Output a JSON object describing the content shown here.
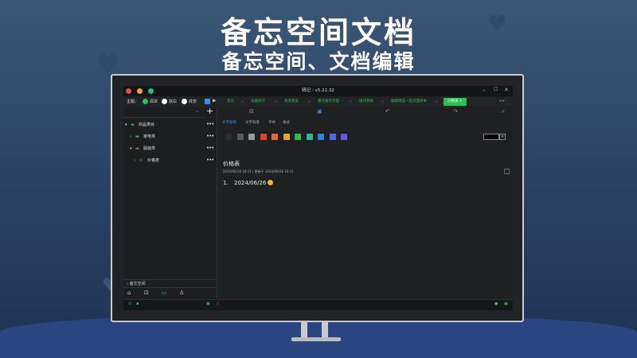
{
  "promo": {
    "title": "备忘空间文档",
    "subtitle": "备忘空间、文档编辑"
  },
  "window": {
    "title": "晴记 - v5.22.32"
  },
  "toolbar": {
    "theme_label": "主题:",
    "theme_options": [
      "翡翠",
      "默白",
      "抹茶"
    ],
    "tabs": [
      "首页",
      "设置统计",
      "背景图案",
      "重点展示页面",
      "操作系统",
      "编辑精选一些页面样本",
      "价格表"
    ],
    "active_tab": "价格表"
  },
  "sidebar": {
    "tree": [
      {
        "label": "商品类目",
        "level": 0
      },
      {
        "label": "家电类",
        "level": 1
      },
      {
        "label": "服装类",
        "level": 1
      },
      {
        "label": "价格表",
        "level": 2
      }
    ],
    "footer_label": "备忘空间"
  },
  "editor": {
    "format_tabs": [
      "文字颜色",
      "文字背景",
      "字体",
      "格式"
    ],
    "active_format_tab": "文字颜色",
    "swatches": [
      "#2c2c2e",
      "#5a5a5a",
      "#9a9a9a",
      "#e23d3d",
      "#e8663a",
      "#e5a630",
      "#2fb84e",
      "#35b58a",
      "#2f86e0",
      "#4a6be8",
      "#6657e6"
    ],
    "doc_title": "价格表",
    "doc_meta": "2024/06/26 16:11  |  更新于 2024/06/26 16:11",
    "list_num": "1.",
    "list_text": "2024/06/26"
  },
  "colors": {
    "accent": "#2bbf57",
    "link": "#3c8ce7"
  }
}
